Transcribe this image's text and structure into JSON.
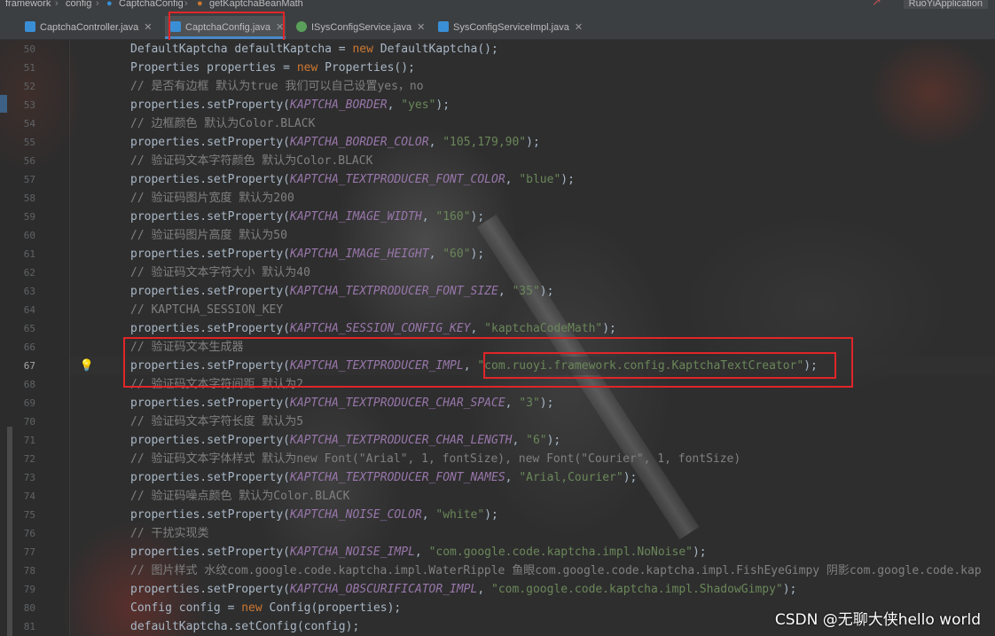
{
  "breadcrumb": {
    "items": [
      "framework",
      "config",
      "CaptchaConfig",
      "getKaptchaBeanMath"
    ],
    "separator": "›"
  },
  "run_config": "RuoYiApplication",
  "tabs": [
    {
      "label": "CaptchaController.java",
      "icon": "java-class-icon",
      "active": false
    },
    {
      "label": "CaptchaConfig.java",
      "icon": "java-class-icon",
      "active": true
    },
    {
      "label": "ISysConfigService.java",
      "icon": "java-interface-icon",
      "active": false
    },
    {
      "label": "SysConfigServiceImpl.java",
      "icon": "java-class-icon",
      "active": false
    }
  ],
  "editor": {
    "current_line": 67,
    "lines": [
      {
        "n": 50,
        "parts": [
          [
            "DefaultKaptcha defaultKaptcha = ",
            "tx"
          ],
          [
            "new ",
            "kw"
          ],
          [
            "DefaultKaptcha();",
            "tx"
          ]
        ]
      },
      {
        "n": 51,
        "parts": [
          [
            "Properties properties = ",
            "tx"
          ],
          [
            "new ",
            "kw"
          ],
          [
            "Properties();",
            "tx"
          ]
        ]
      },
      {
        "n": 52,
        "parts": [
          [
            "// 是否有边框 默认为true 我们可以自己设置yes，no",
            "cm"
          ]
        ]
      },
      {
        "n": 53,
        "parts": [
          [
            "properties.setProperty(",
            "tx"
          ],
          [
            "KAPTCHA_BORDER",
            "cn"
          ],
          [
            ", ",
            "tx"
          ],
          [
            "\"yes\"",
            "st"
          ],
          [
            ");",
            "tx"
          ]
        ]
      },
      {
        "n": 54,
        "parts": [
          [
            "// 边框颜色 默认为Color.BLACK",
            "cm"
          ]
        ]
      },
      {
        "n": 55,
        "parts": [
          [
            "properties.setProperty(",
            "tx"
          ],
          [
            "KAPTCHA_BORDER_COLOR",
            "cn"
          ],
          [
            ", ",
            "tx"
          ],
          [
            "\"105,179,90\"",
            "st"
          ],
          [
            ");",
            "tx"
          ]
        ]
      },
      {
        "n": 56,
        "parts": [
          [
            "// 验证码文本字符颜色 默认为Color.BLACK",
            "cm"
          ]
        ]
      },
      {
        "n": 57,
        "parts": [
          [
            "properties.setProperty(",
            "tx"
          ],
          [
            "KAPTCHA_TEXTPRODUCER_FONT_COLOR",
            "cn"
          ],
          [
            ", ",
            "tx"
          ],
          [
            "\"blue\"",
            "st"
          ],
          [
            ");",
            "tx"
          ]
        ]
      },
      {
        "n": 58,
        "parts": [
          [
            "// 验证码图片宽度 默认为200",
            "cm"
          ]
        ]
      },
      {
        "n": 59,
        "parts": [
          [
            "properties.setProperty(",
            "tx"
          ],
          [
            "KAPTCHA_IMAGE_WIDTH",
            "cn"
          ],
          [
            ", ",
            "tx"
          ],
          [
            "\"160\"",
            "st"
          ],
          [
            ");",
            "tx"
          ]
        ]
      },
      {
        "n": 60,
        "parts": [
          [
            "// 验证码图片高度 默认为50",
            "cm"
          ]
        ]
      },
      {
        "n": 61,
        "parts": [
          [
            "properties.setProperty(",
            "tx"
          ],
          [
            "KAPTCHA_IMAGE_HEIGHT",
            "cn"
          ],
          [
            ", ",
            "tx"
          ],
          [
            "\"60\"",
            "st"
          ],
          [
            ");",
            "tx"
          ]
        ]
      },
      {
        "n": 62,
        "parts": [
          [
            "// 验证码文本字符大小 默认为40",
            "cm"
          ]
        ]
      },
      {
        "n": 63,
        "parts": [
          [
            "properties.setProperty(",
            "tx"
          ],
          [
            "KAPTCHA_TEXTPRODUCER_FONT_SIZE",
            "cn"
          ],
          [
            ", ",
            "tx"
          ],
          [
            "\"35\"",
            "st"
          ],
          [
            ");",
            "tx"
          ]
        ]
      },
      {
        "n": 64,
        "parts": [
          [
            "// KAPTCHA_SESSION_KEY",
            "cm"
          ]
        ]
      },
      {
        "n": 65,
        "parts": [
          [
            "properties.setProperty(",
            "tx"
          ],
          [
            "KAPTCHA_SESSION_CONFIG_KEY",
            "cn"
          ],
          [
            ", ",
            "tx"
          ],
          [
            "\"kaptchaCodeMath\"",
            "st"
          ],
          [
            ");",
            "tx"
          ]
        ]
      },
      {
        "n": 66,
        "parts": [
          [
            "// 验证码文本生成器",
            "cm"
          ]
        ]
      },
      {
        "n": 67,
        "parts": [
          [
            "properties.setProperty(",
            "tx"
          ],
          [
            "KAPTCHA_TEXTPRODUCER_IMPL",
            "cn"
          ],
          [
            ", ",
            "tx"
          ],
          [
            "\"com.ruoyi.framework.config.KaptchaTextCreator\"",
            "st"
          ],
          [
            ");",
            "tx"
          ]
        ]
      },
      {
        "n": 68,
        "parts": [
          [
            "// 验证码文本字符间距 默认为2",
            "cm"
          ]
        ]
      },
      {
        "n": 69,
        "parts": [
          [
            "properties.setProperty(",
            "tx"
          ],
          [
            "KAPTCHA_TEXTPRODUCER_CHAR_SPACE",
            "cn"
          ],
          [
            ", ",
            "tx"
          ],
          [
            "\"3\"",
            "st"
          ],
          [
            ");",
            "tx"
          ]
        ]
      },
      {
        "n": 70,
        "parts": [
          [
            "// 验证码文本字符长度 默认为5",
            "cm"
          ]
        ]
      },
      {
        "n": 71,
        "parts": [
          [
            "properties.setProperty(",
            "tx"
          ],
          [
            "KAPTCHA_TEXTPRODUCER_CHAR_LENGTH",
            "cn"
          ],
          [
            ", ",
            "tx"
          ],
          [
            "\"6\"",
            "st"
          ],
          [
            ");",
            "tx"
          ]
        ]
      },
      {
        "n": 72,
        "parts": [
          [
            "// 验证码文本字体样式 默认为new Font(\"Arial\", 1, fontSize), new Font(\"Courier\", 1, fontSize)",
            "cm"
          ]
        ]
      },
      {
        "n": 73,
        "parts": [
          [
            "properties.setProperty(",
            "tx"
          ],
          [
            "KAPTCHA_TEXTPRODUCER_FONT_NAMES",
            "cn"
          ],
          [
            ", ",
            "tx"
          ],
          [
            "\"Arial,Courier\"",
            "st"
          ],
          [
            ");",
            "tx"
          ]
        ]
      },
      {
        "n": 74,
        "parts": [
          [
            "// 验证码噪点颜色 默认为Color.BLACK",
            "cm"
          ]
        ]
      },
      {
        "n": 75,
        "parts": [
          [
            "properties.setProperty(",
            "tx"
          ],
          [
            "KAPTCHA_NOISE_COLOR",
            "cn"
          ],
          [
            ", ",
            "tx"
          ],
          [
            "\"white\"",
            "st"
          ],
          [
            ");",
            "tx"
          ]
        ]
      },
      {
        "n": 76,
        "parts": [
          [
            "// 干扰实现类",
            "cm"
          ]
        ]
      },
      {
        "n": 77,
        "parts": [
          [
            "properties.setProperty(",
            "tx"
          ],
          [
            "KAPTCHA_NOISE_IMPL",
            "cn"
          ],
          [
            ", ",
            "tx"
          ],
          [
            "\"com.google.code.kaptcha.impl.NoNoise\"",
            "st"
          ],
          [
            ");",
            "tx"
          ]
        ]
      },
      {
        "n": 78,
        "parts": [
          [
            "// 图片样式 水纹com.google.code.kaptcha.impl.WaterRipple 鱼眼com.google.code.kaptcha.impl.FishEyeGimpy 阴影com.google.code.kap",
            "cm"
          ]
        ]
      },
      {
        "n": 79,
        "parts": [
          [
            "properties.setProperty(",
            "tx"
          ],
          [
            "KAPTCHA_OBSCURIFICATOR_IMPL",
            "cn"
          ],
          [
            ", ",
            "tx"
          ],
          [
            "\"com.google.code.kaptcha.impl.ShadowGimpy\"",
            "st"
          ],
          [
            ");",
            "tx"
          ]
        ]
      },
      {
        "n": 80,
        "parts": [
          [
            "Config config = ",
            "tx"
          ],
          [
            "new ",
            "kw"
          ],
          [
            "Config(properties);",
            "tx"
          ]
        ]
      },
      {
        "n": 81,
        "parts": [
          [
            "defaultKaptcha.setConfig(config);",
            "tx"
          ]
        ]
      }
    ]
  },
  "intention_icon": "lightbulb-icon",
  "watermark": "CSDN @无聊大侠hello world",
  "colors": {
    "keyword": "#cc7832",
    "comment": "#808080",
    "string": "#6a8759",
    "constant": "#9876aa",
    "text": "#a9b7c6",
    "highlight_box": "#e0252a"
  }
}
